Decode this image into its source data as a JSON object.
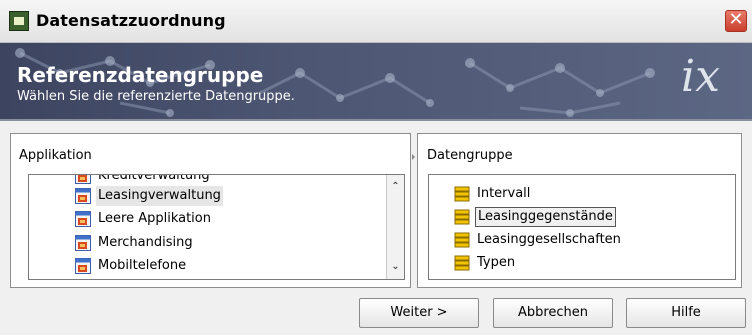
{
  "window": {
    "title": "Datensatzzuordnung",
    "close_glyph": "✕",
    "close_icon": "close-icon",
    "app_icon": "app-icon"
  },
  "banner": {
    "title": "Referenzdatengruppe",
    "subtitle": "Wählen Sie die referenzierte Datengruppe.",
    "logo_text": "ix",
    "background": "#4d5672"
  },
  "left_panel": {
    "label": "Applikation",
    "items": [
      {
        "label": "Kreditverwaltung",
        "icon": "application-icon",
        "selected": false
      },
      {
        "label": "Leasingverwaltung",
        "icon": "application-icon",
        "selected": true
      },
      {
        "label": "Leere Applikation",
        "icon": "application-icon",
        "selected": false
      },
      {
        "label": "Merchandising",
        "icon": "application-icon",
        "selected": false
      },
      {
        "label": "Mobiltelefone",
        "icon": "application-icon",
        "selected": false
      }
    ],
    "scroll_up_glyph": "⌃",
    "scroll_down_glyph": "⌄"
  },
  "right_panel": {
    "label": "Datengruppe",
    "items": [
      {
        "label": "Intervall",
        "icon": "database-icon",
        "selected": false
      },
      {
        "label": "Leasinggegenstände",
        "icon": "database-icon",
        "selected": true
      },
      {
        "label": "Leasinggesellschaften",
        "icon": "database-icon",
        "selected": false
      },
      {
        "label": "Typen",
        "icon": "database-icon",
        "selected": false
      }
    ]
  },
  "buttons": {
    "next": "Weiter >",
    "cancel": "Abbrechen",
    "help": "Hilfe"
  },
  "colors": {
    "selection": "#e6e6e6",
    "content_bg": "#f0f0f0",
    "close_red": "#d14a38"
  }
}
